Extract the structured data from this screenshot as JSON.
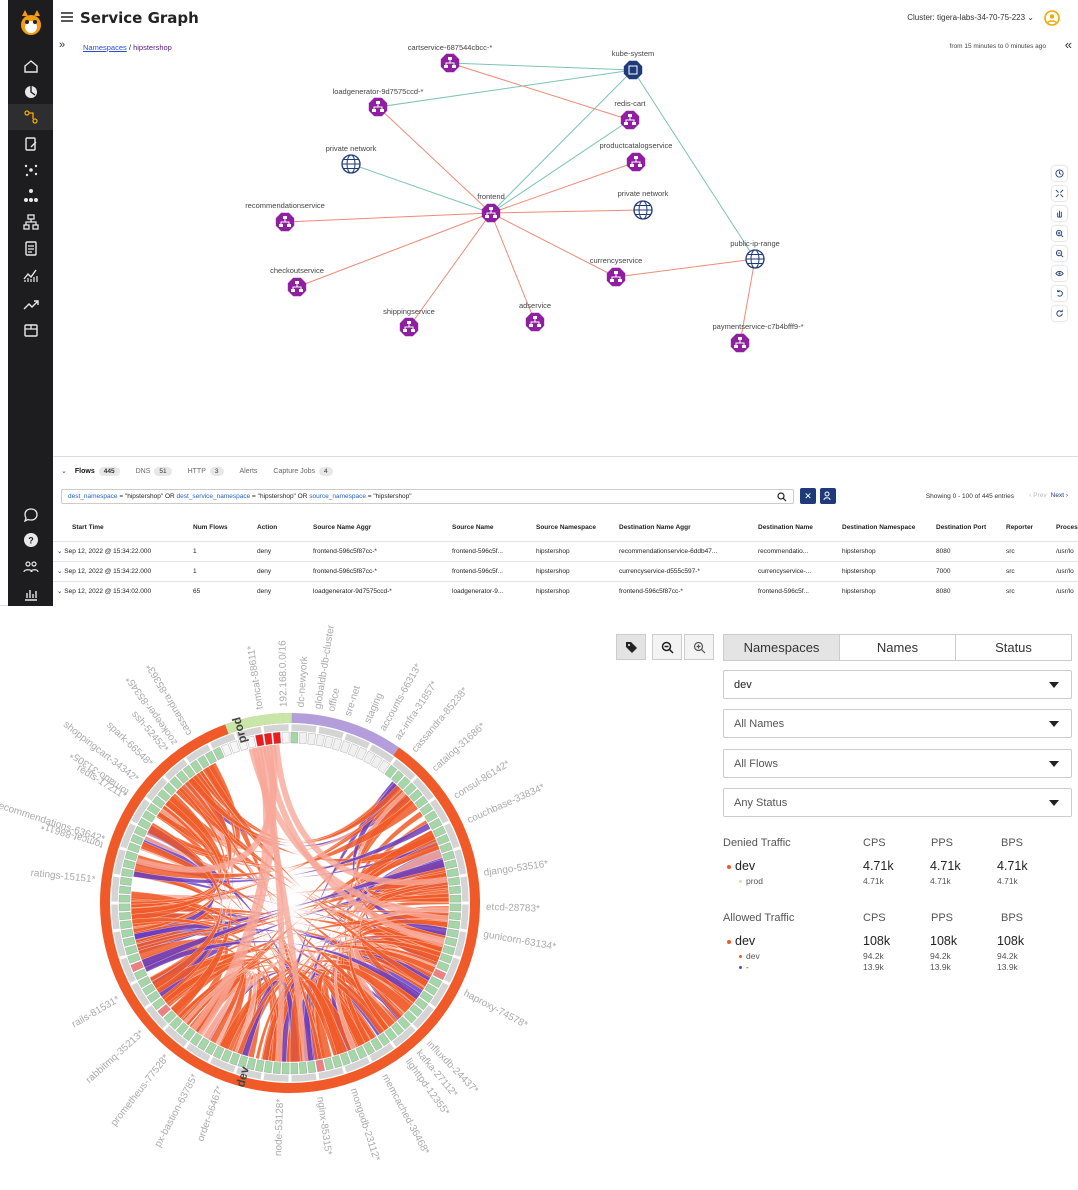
{
  "app": {
    "title": "Service Graph",
    "cluster": "Cluster: tigera-labs-34-70-75-223",
    "breadcrumb": {
      "root": "Namespaces",
      "sep": "/",
      "current": "hipstershop"
    },
    "time_range": "from 15 minutes to 0 minutes ago"
  },
  "sidebar_items": [
    "home-icon",
    "dashboard-icon",
    "service-graph-icon",
    "policies-icon",
    "endpoints-icon",
    "node-graph-icon",
    "network-icon",
    "compliance-icon",
    "activity-icon",
    "trend-icon",
    "storage-icon",
    "chat-icon",
    "help-icon",
    "users-icon",
    "reports-icon"
  ],
  "graph": {
    "nodes": [
      {
        "label": "cartservice-687544cbcc-*",
        "kind": "service"
      },
      {
        "label": "kube-system",
        "kind": "namespace"
      },
      {
        "label": "loadgenerator-9d7575ccd-*",
        "kind": "service"
      },
      {
        "label": "redis-cart",
        "kind": "service"
      },
      {
        "label": "private network",
        "kind": "network"
      },
      {
        "label": "productcatalogservice",
        "kind": "service"
      },
      {
        "label": "frontend",
        "kind": "service"
      },
      {
        "label": "private network",
        "kind": "network"
      },
      {
        "label": "recommendationservice",
        "kind": "service"
      },
      {
        "label": "public-ip-range",
        "kind": "network"
      },
      {
        "label": "currencyservice",
        "kind": "service"
      },
      {
        "label": "checkoutservice",
        "kind": "service"
      },
      {
        "label": "adservice",
        "kind": "service"
      },
      {
        "label": "shippingservice",
        "kind": "service"
      },
      {
        "label": "paymentservice-c7b4bfff9-*",
        "kind": "service"
      }
    ]
  },
  "flows": {
    "tabs": [
      {
        "label": "Flows",
        "count": "445"
      },
      {
        "label": "DNS",
        "count": "51"
      },
      {
        "label": "HTTP",
        "count": "3"
      },
      {
        "label": "Alerts",
        "count": ""
      },
      {
        "label": "Capture Jobs",
        "count": "4"
      }
    ],
    "filter": {
      "k1": "dest_namespace",
      "v1": " = \"hipstershop\" OR ",
      "k2": "dest_service_namespace",
      "v2": " = \"hipstershop\" OR ",
      "k3": "source_namespace",
      "v3": " = \"hipstershop\""
    },
    "entries": "Showing 0 - 100 of 445 entries",
    "prev": "Prev",
    "next": "Next",
    "columns": [
      "Start Time",
      "Num Flows",
      "Action",
      "Source Name Aggr",
      "Source Name",
      "Source Namespace",
      "Destination Name Aggr",
      "Destination Name",
      "Destination Namespace",
      "Destination Port",
      "Reporter",
      "Process"
    ],
    "rows": [
      [
        "Sep 12, 2022 @ 15:34:22.000",
        "1",
        "deny",
        "frontend-596c5f87cc-*",
        "frontend-596c5f...",
        "hipstershop",
        "recommendationservice-6ddb47...",
        "recommendatio...",
        "hipstershop",
        "8080",
        "src",
        "/usr/lo"
      ],
      [
        "Sep 12, 2022 @ 15:34:22.000",
        "1",
        "deny",
        "frontend-596c5f87cc-*",
        "frontend-596c5f...",
        "hipstershop",
        "currencyservice-d555c597-*",
        "currencyservice-...",
        "hipstershop",
        "7000",
        "src",
        "/usr/lo"
      ],
      [
        "Sep 12, 2022 @ 15:34:02.000",
        "65",
        "deny",
        "loadgenerator-9d7575ccd-*",
        "loadgenerator-9...",
        "hipstershop",
        "frontend-596c5f87cc-*",
        "frontend-596c5f...",
        "hipstershop",
        "8080",
        "src",
        "/usr/lo"
      ]
    ]
  },
  "chord": {
    "labels": [
      "tomcat-88611*",
      "tornado-31305*",
      "zookeeper-85345*",
      "cassandra-85363*",
      "prod",
      "tomcat-88611*",
      "192.168.0.0/16",
      "dc-newyork",
      "globaldb-db-cluster",
      "office",
      "sre-net",
      "staging",
      "accounts-66313*",
      "az-infra-31857*",
      "cassandra-85238*",
      "catalog-31686*",
      "consul-86142*",
      "couchbase-33834*",
      "django-53516*",
      "etcd-28783*",
      "gunicorn-63134*",
      "haproxy-74578*",
      "influxdb-24437*",
      "kafka-27112*",
      "lighttpd-12355*",
      "memcached-36468*",
      "mongodb-23112*",
      "nginx-85315*",
      "node-53128*",
      "dev",
      "order-66467*",
      "px-bastion-63785*",
      "prometheus-77528*",
      "rabbitmq-35213*",
      "rails-81531*",
      "ratings-15151*",
      "recommendations-63642*",
      "redis-17211*",
      "shoppingcart-34342*",
      "spark-66548*",
      "ssh-52452*"
    ],
    "colors": {
      "dev": "#f05a28",
      "prod": "#c8e6a8",
      "staging": "#b39ddb",
      "purple": "#6a3dbf",
      "green": "#a5d6a7",
      "red": "#ee1c1c"
    }
  },
  "controls": {
    "tabs": [
      "Namespaces",
      "Names",
      "Status"
    ],
    "dropdowns": [
      "dev",
      "All Names",
      "All Flows",
      "Any Status"
    ]
  },
  "stats": {
    "denied": {
      "title": "Denied Traffic",
      "cols": [
        "CPS",
        "PPS",
        "BPS"
      ],
      "main": {
        "name": "dev",
        "cps": "4.71k",
        "pps": "4.71k",
        "bps": "4.71k"
      },
      "sub": [
        {
          "name": "prod",
          "cps": "4.71k",
          "pps": "4.71k",
          "bps": "4.71k"
        }
      ]
    },
    "allowed": {
      "title": "Allowed Traffic",
      "cols": [
        "CPS",
        "PPS",
        "BPS"
      ],
      "main": {
        "name": "dev",
        "cps": "108k",
        "pps": "108k",
        "bps": "108k"
      },
      "sub": [
        {
          "name": "dev",
          "cps": "94.2k",
          "pps": "94.2k",
          "bps": "94.2k"
        },
        {
          "name": "-",
          "cps": "13.9k",
          "pps": "13.9k",
          "bps": "13.9k"
        }
      ]
    }
  }
}
